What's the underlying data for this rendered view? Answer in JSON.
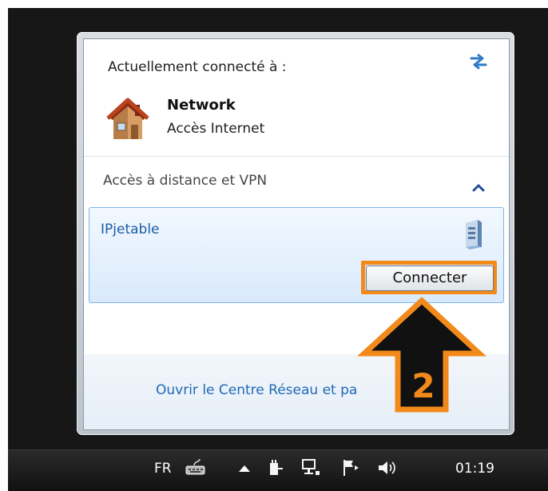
{
  "popup": {
    "current_title": "Actuellement connecté à :",
    "network": {
      "name": "Network",
      "status": "Accès Internet"
    },
    "vpn_section": {
      "title": "Accès à distance et VPN",
      "item": {
        "name": "IPjetable",
        "connect_label": "Connecter"
      }
    },
    "footer_link": "Ouvrir le Centre Réseau et pa"
  },
  "callout": {
    "number": "2",
    "color": "#f28a1b"
  },
  "taskbar": {
    "language": "FR",
    "time": "01:19"
  },
  "icons": {
    "refresh": "refresh-icon",
    "network_home": "home-network-icon",
    "collapse": "chevron-up-icon",
    "server": "server-icon",
    "keyboard": "keyboard-icon",
    "show_hidden": "up-arrow-icon",
    "power": "power-icon",
    "network_tray": "network-icon",
    "flag": "action-center-flag-icon",
    "volume": "volume-icon"
  }
}
